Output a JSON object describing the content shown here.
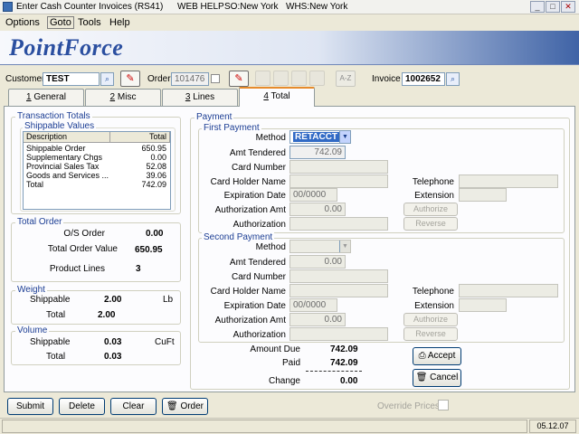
{
  "window": {
    "app_title": "Enter Cash Counter Invoices (RS41)",
    "help": "WEB HELP",
    "so": "SO:New York",
    "whs": "WHS:New York"
  },
  "menu": [
    "Options",
    "Goto",
    "Tools",
    "Help"
  ],
  "brand": "PointForce",
  "header": {
    "customer_label": "Customer",
    "customer_value": "TEST",
    "order_label": "Order",
    "order_value": "101476",
    "az_label": "A-Z",
    "invoice_label": "Invoice",
    "invoice_value": "1002652"
  },
  "tabs": [
    {
      "num": "1",
      "label": " General"
    },
    {
      "num": "2",
      "label": " Misc"
    },
    {
      "num": "3",
      "label": " Lines"
    },
    {
      "num": "4",
      "label": " Total"
    }
  ],
  "transaction_totals": {
    "title": "Transaction Totals",
    "shippable_title": "Shippable Values",
    "columns": [
      "Description",
      "Total"
    ],
    "rows": [
      {
        "desc": "Shippable Order",
        "total": "650.95"
      },
      {
        "desc": "Supplementary Chgs",
        "total": "0.00"
      },
      {
        "desc": "Provincial Sales Tax",
        "total": "52.08"
      },
      {
        "desc": "Goods and Services ...",
        "total": "39.06"
      },
      {
        "desc": "Total",
        "total": "742.09"
      }
    ]
  },
  "total_order": {
    "title": "Total Order",
    "os_order_label": "O/S Order",
    "os_order_value": "0.00",
    "total_value_label": "Total Order Value",
    "total_value": "650.95",
    "product_lines_label": "Product Lines",
    "product_lines_value": "3"
  },
  "weight": {
    "title": "Weight",
    "shippable_label": "Shippable",
    "shippable_value": "2.00",
    "unit": "Lb",
    "total_label": "Total",
    "total_value": "2.00"
  },
  "volume": {
    "title": "Volume",
    "shippable_label": "Shippable",
    "shippable_value": "0.03",
    "unit": "CuFt",
    "total_label": "Total",
    "total_value": "0.03"
  },
  "payment": {
    "title": "Payment",
    "first": {
      "title": "First Payment",
      "method_label": "Method",
      "method_value": "RETACCT",
      "amt_tendered_label": "Amt Tendered",
      "amt_tendered_value": "742.09",
      "card_number_label": "Card Number",
      "card_holder_label": "Card Holder Name",
      "telephone_label": "Telephone",
      "expiration_label": "Expiration Date",
      "expiration_value": "00/0000",
      "extension_label": "Extension",
      "auth_amt_label": "Authorization Amt",
      "auth_amt_value": "0.00",
      "authorize_button": "Authorize",
      "authorization_label": "Authorization",
      "reverse_button": "Reverse"
    },
    "second": {
      "title": "Second Payment",
      "method_label": "Method",
      "amt_tendered_label": "Amt Tendered",
      "amt_tendered_value": "0.00",
      "card_number_label": "Card Number",
      "card_holder_label": "Card Holder Name",
      "telephone_label": "Telephone",
      "expiration_label": "Expiration Date",
      "expiration_value": "00/0000",
      "extension_label": "Extension",
      "auth_amt_label": "Authorization Amt",
      "auth_amt_value": "0.00",
      "authorize_button": "Authorize",
      "authorization_label": "Authorization",
      "reverse_button": "Reverse"
    },
    "amount_due_label": "Amount Due",
    "amount_due_value": "742.09",
    "paid_label": "Paid",
    "paid_value": "742.09",
    "change_label": "Change",
    "change_value": "0.00",
    "accept_button": "Accept",
    "cancel_button": "Cancel"
  },
  "footer": {
    "submit": "Submit",
    "delete": "Delete",
    "clear": "Clear",
    "order": "Order",
    "override_prices": "Override Prices"
  },
  "status": {
    "version": "05.12.07"
  }
}
